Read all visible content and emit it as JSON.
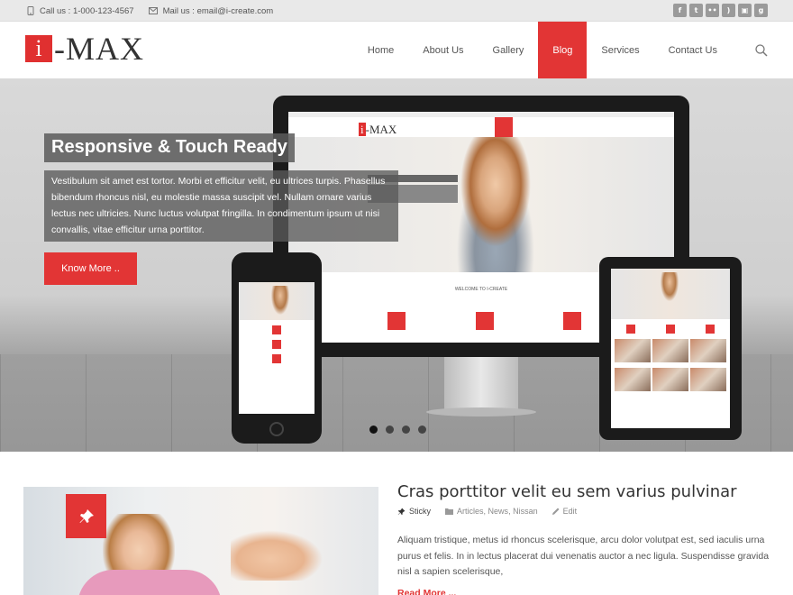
{
  "topbar": {
    "call": "Call us : 1-000-123-4567",
    "mail": "Mail us : email@i-create.com",
    "social": [
      "f",
      "t",
      "••",
      "rss",
      "ig",
      "g+"
    ]
  },
  "logo": {
    "mark": "i",
    "text": "-MAX"
  },
  "nav": {
    "items": [
      "Home",
      "About Us",
      "Gallery",
      "Blog",
      "Services",
      "Contact Us"
    ],
    "active": "Blog"
  },
  "hero": {
    "title": "Responsive & Touch Ready",
    "text": "Vestibulum sit amet est tortor. Morbi et efficitur velit, eu ultrices turpis. Phasellus bibendum rhoncus nisl, eu molestie massa suscipit vel. Nullam ornare varius lectus nec ultricies. Nunc luctus volutpat fringilla. In condimentum ipsum ut nisi convallis, vitae efficitur urna porttitor.",
    "button": "Know More ..",
    "slides": 4,
    "active_slide": 1,
    "mini_logo": {
      "mark": "i",
      "text": "-MAX"
    },
    "mini_welcome": "WELCOME TO I-CREATE"
  },
  "post": {
    "title": "Cras porttitor velit eu sem varius pulvinar",
    "sticky": "Sticky",
    "categories": [
      "Articles",
      "News",
      "Nissan"
    ],
    "edit": "Edit",
    "excerpt": "Aliquam tristique, metus id rhoncus scelerisque, arcu dolor volutpat est, sed iaculis urna purus et felis. In in lectus placerat dui venenatis auctor a nec ligula. Suspendisse gravida nisl a sapien scelerisque,",
    "read_more": "Read More ..."
  },
  "colors": {
    "accent": "#e23535",
    "topbar": "#e9e9e9"
  }
}
